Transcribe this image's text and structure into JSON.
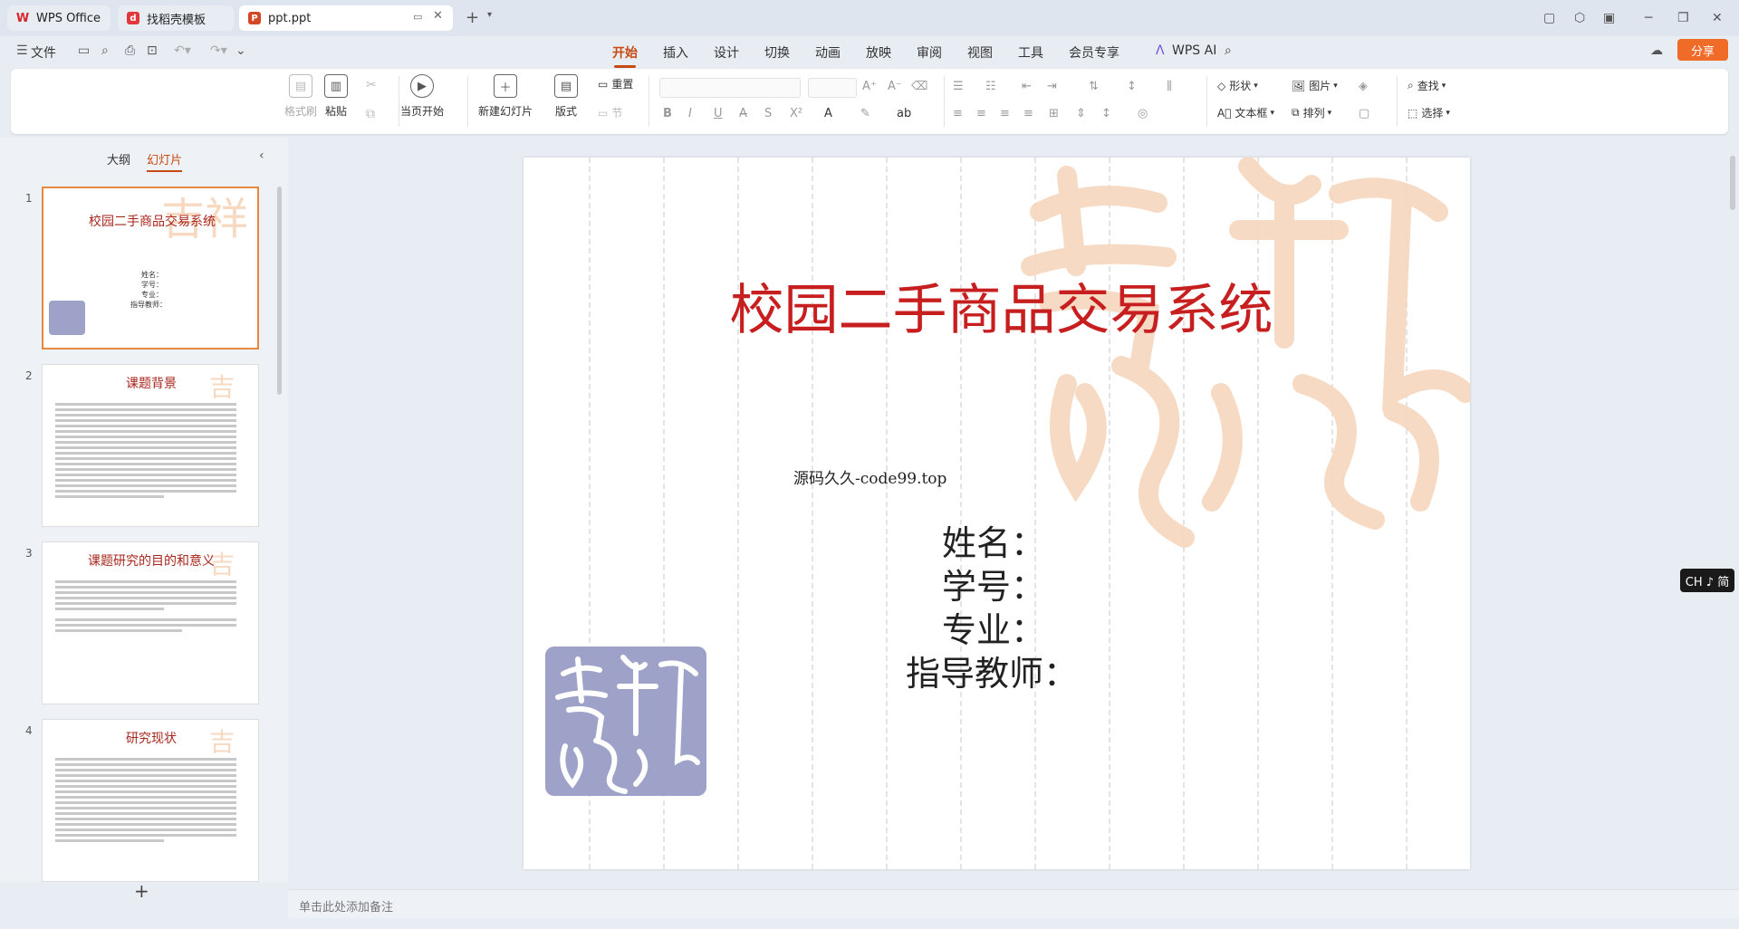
{
  "tabs": [
    {
      "label": "WPS Office"
    },
    {
      "label": "找稻壳模板"
    },
    {
      "label": "ppt.ppt"
    }
  ],
  "menu": {
    "file": "文件",
    "items": [
      "开始",
      "插入",
      "设计",
      "切换",
      "动画",
      "放映",
      "审阅",
      "视图",
      "工具",
      "会员专享"
    ],
    "active": "开始",
    "wps_ai": "WPS AI",
    "share": "分享"
  },
  "ribbon": {
    "format_painter": "格式刷",
    "paste": "粘贴",
    "start_slideshow": "当页开始",
    "new_slide": "新建幻灯片",
    "layout": "版式",
    "section": "节",
    "reset": "重置",
    "shape": "形状",
    "picture": "图片",
    "textbox": "文本框",
    "arrange": "排列",
    "find": "查找",
    "select": "选择"
  },
  "panel": {
    "outline_tab": "大纲",
    "slides_tab": "幻灯片",
    "add_slide": "+"
  },
  "thumbnails": [
    {
      "num": "1",
      "title": "校园二手商品交易系统",
      "fields": [
        "姓名：",
        "学号：",
        "专业：",
        "指导教师："
      ]
    },
    {
      "num": "2",
      "title": "课题背景"
    },
    {
      "num": "3",
      "title": "课题研究的目的和意义"
    },
    {
      "num": "4",
      "title": "研究现状"
    }
  ],
  "slide": {
    "title": "校园二手商品交易系统",
    "source_text": "源码久久-code99.top",
    "fields": [
      "姓名：",
      "学号：",
      "专业：",
      "指导教师："
    ]
  },
  "notes_placeholder": "单击此处添加备注",
  "ime": "CH ♪ 简",
  "colors": {
    "accent": "#c84a12",
    "share": "#f06a28",
    "slide_title": "#c71f1f",
    "seal": "#9ea2c8",
    "deco": "#f7d7bd"
  }
}
